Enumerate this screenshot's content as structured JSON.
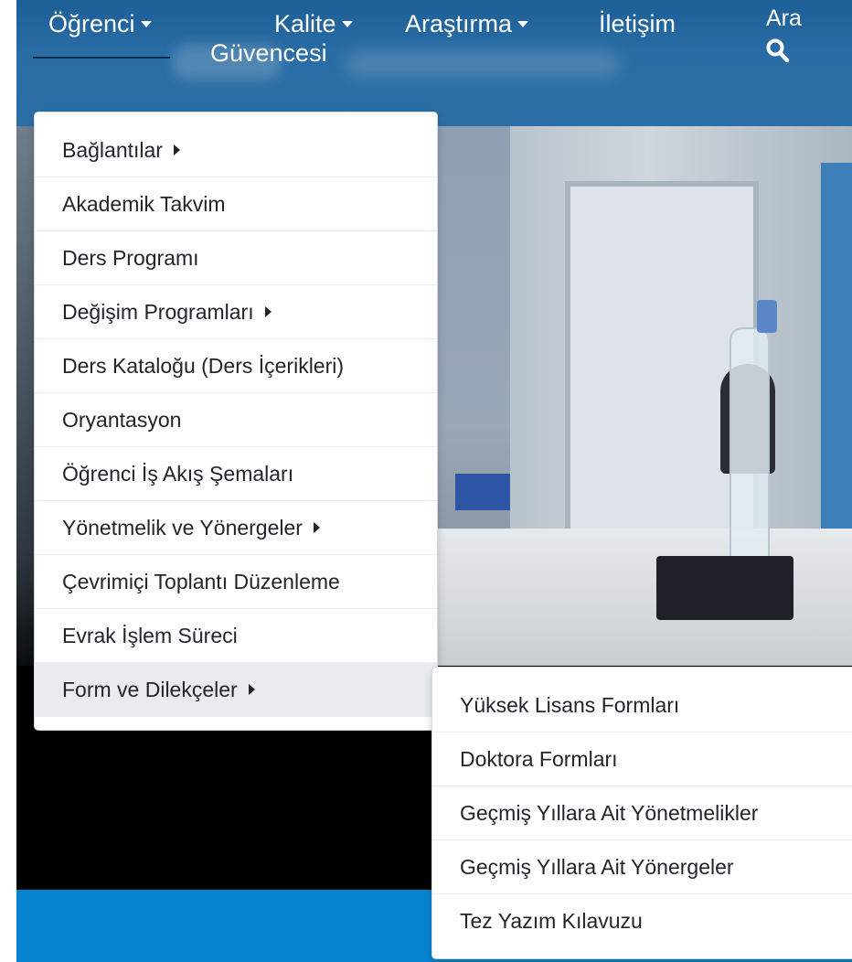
{
  "navbar": {
    "items": [
      {
        "label": "Öğrenci",
        "has_caret": true,
        "active": true
      },
      {
        "label_line1": "Kalite",
        "label_line2": "Güvencesi",
        "has_caret": true
      },
      {
        "label": "Araştırma",
        "has_caret": true
      },
      {
        "label": "İletişim",
        "has_caret": false
      }
    ],
    "search": {
      "label": "Ara",
      "icon": "search-icon"
    }
  },
  "dropdown": {
    "items": [
      {
        "label": "Bağlantılar",
        "has_submenu": true
      },
      {
        "label": "Akademik Takvim",
        "has_submenu": false
      },
      {
        "label": "Ders Programı",
        "has_submenu": false
      },
      {
        "label": "Değişim Programları",
        "has_submenu": true
      },
      {
        "label": "Ders Kataloğu (Ders İçerikleri)",
        "has_submenu": false
      },
      {
        "label": "Oryantasyon",
        "has_submenu": false
      },
      {
        "label": "Öğrenci İş Akış Şemaları",
        "has_submenu": false
      },
      {
        "label": "Yönetmelik ve Yönergeler",
        "has_submenu": true
      },
      {
        "label": "Çevrimiçi Toplantı Düzenleme",
        "has_submenu": false
      },
      {
        "label": "Evrak İşlem Süreci",
        "has_submenu": false
      },
      {
        "label": "Form ve Dilekçeler",
        "has_submenu": true,
        "active": true
      }
    ]
  },
  "submenu": {
    "items": [
      {
        "label": "Yüksek Lisans Formları"
      },
      {
        "label": "Doktora Formları"
      },
      {
        "label": "Geçmiş Yıllara Ait Yönetmelikler"
      },
      {
        "label": "Geçmiş Yıllara Ait Yönergeler"
      },
      {
        "label": "Tez Yazım Kılavuzu"
      }
    ]
  },
  "colors": {
    "navbar": "#2a6da6",
    "menu_text": "#212529",
    "active_item_bg": "#e9ecef",
    "footer_band": "#0784d0"
  }
}
